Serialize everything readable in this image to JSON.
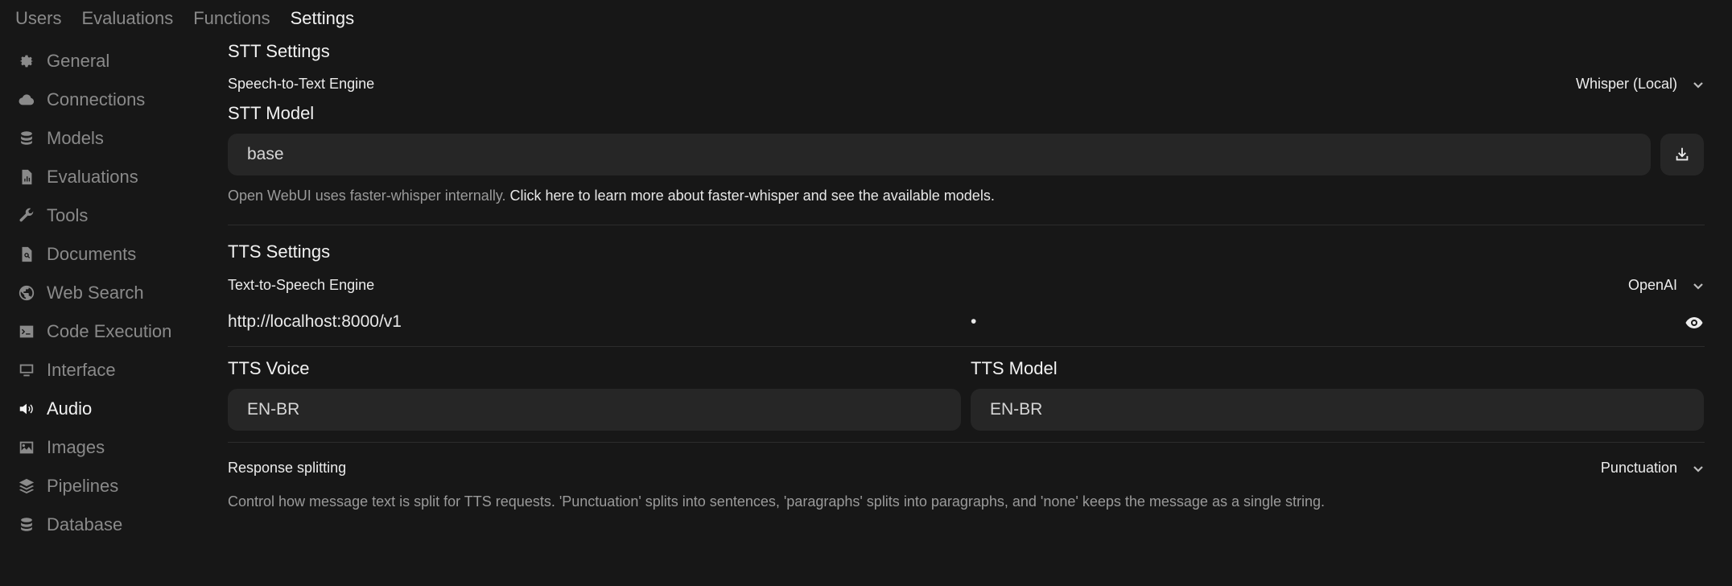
{
  "topnav": {
    "tabs": [
      "Users",
      "Evaluations",
      "Functions",
      "Settings"
    ],
    "active": "Settings"
  },
  "sidebar": {
    "items": [
      {
        "label": "General",
        "icon": "gear-icon"
      },
      {
        "label": "Connections",
        "icon": "cloud-icon"
      },
      {
        "label": "Models",
        "icon": "database-icon"
      },
      {
        "label": "Evaluations",
        "icon": "document-chart-icon"
      },
      {
        "label": "Tools",
        "icon": "wrench-icon"
      },
      {
        "label": "Documents",
        "icon": "document-search-icon"
      },
      {
        "label": "Web Search",
        "icon": "globe-icon"
      },
      {
        "label": "Code Execution",
        "icon": "terminal-icon"
      },
      {
        "label": "Interface",
        "icon": "monitor-icon"
      },
      {
        "label": "Audio",
        "icon": "speaker-icon"
      },
      {
        "label": "Images",
        "icon": "image-icon"
      },
      {
        "label": "Pipelines",
        "icon": "layers-icon"
      },
      {
        "label": "Database",
        "icon": "database-icon"
      }
    ],
    "active": "Audio"
  },
  "stt": {
    "heading": "STT Settings",
    "engine_label": "Speech-to-Text Engine",
    "engine_value": "Whisper (Local)",
    "model_label": "STT Model",
    "model_value": "base",
    "help_text": "Open WebUI uses faster-whisper internally.",
    "help_link": "Click here to learn more about faster-whisper and see the available models."
  },
  "tts": {
    "heading": "TTS Settings",
    "engine_label": "Text-to-Speech Engine",
    "engine_value": "OpenAI",
    "api_base_url": "http://localhost:8000/v1",
    "api_key_masked": "•",
    "voice_label": "TTS Voice",
    "voice_value": "EN-BR",
    "model_label": "TTS Model",
    "model_value": "EN-BR",
    "splitting_label": "Response splitting",
    "splitting_value": "Punctuation",
    "splitting_help": "Control how message text is split for TTS requests. 'Punctuation' splits into sentences, 'paragraphs' splits into paragraphs, and 'none' keeps the message as a single string."
  },
  "colors": {
    "background": "#171717",
    "input_bg": "#262626",
    "muted": "#8a8a8a",
    "text": "#e5e5e5"
  }
}
